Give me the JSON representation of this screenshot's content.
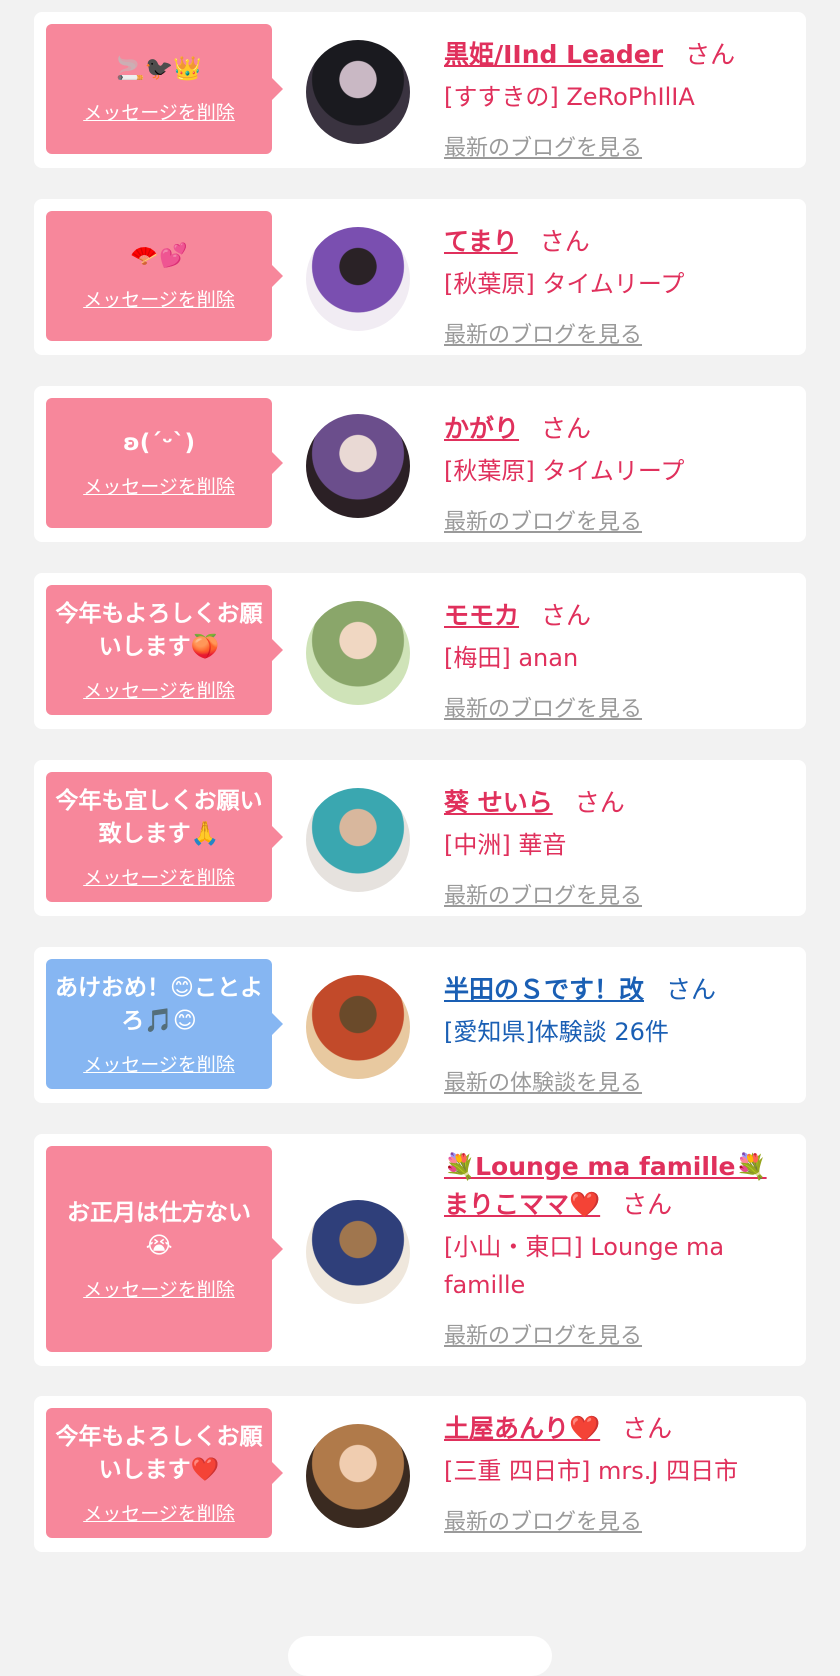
{
  "delete_label": "メッセージを削除",
  "san_label": "さん",
  "cards": [
    {
      "message": "🚬🐦‍⬛👑",
      "name": "黒姫/IInd Leader",
      "shop": "[すすきの] ZeRoPhIlIA",
      "latest": "最新のブログを見る",
      "theme": "pink",
      "avatar_colors": [
        "#3a3340",
        "#1a1a1f",
        "#c9b8c4"
      ]
    },
    {
      "message": "🪭💕",
      "name": "てまり",
      "shop": "[秋葉原] タイムリープ",
      "latest": "最新のブログを見る",
      "theme": "pink",
      "avatar_colors": [
        "#f1ecf3",
        "#7a4fb0",
        "#2a2226"
      ]
    },
    {
      "message": "ʚ(ˊᵕˋ)",
      "name": "かがり",
      "shop": "[秋葉原] タイムリープ",
      "latest": "最新のブログを見る",
      "theme": "pink",
      "avatar_colors": [
        "#2b2025",
        "#6b4e8c",
        "#e9d9d4"
      ]
    },
    {
      "message": "今年もよろしくお願いします🍑",
      "name": "モモカ",
      "shop": "[梅田] anan",
      "latest": "最新のブログを見る",
      "theme": "pink",
      "avatar_colors": [
        "#cfe3b8",
        "#8aa66a",
        "#f0d7c2"
      ]
    },
    {
      "message": "今年も宜しくお願い致します🙏",
      "name": "葵 せいら",
      "shop": "[中洲] 華音",
      "latest": "最新のブログを見る",
      "theme": "pink",
      "avatar_colors": [
        "#e6e2de",
        "#3aa7b0",
        "#d8b79d"
      ]
    },
    {
      "message": "あけおめ！😊ことよろ🎵😊",
      "name": "半田のＳです！改",
      "shop": "[愛知県]体験談 26件",
      "latest": "最新の体験談を見る",
      "theme": "blue",
      "avatar_colors": [
        "#e8c9a0",
        "#c24a2a",
        "#6a4a2a"
      ]
    },
    {
      "message": "お正月は仕方ない😭",
      "name": "💐Lounge ma famille💐まりこママ❤️",
      "shop": "[小山・東口] Lounge ma famille",
      "latest": "最新のブログを見る",
      "theme": "pink",
      "avatar_colors": [
        "#efe7dc",
        "#2f3f7a",
        "#a0764e"
      ]
    },
    {
      "message": "今年もよろしくお願いします❤️",
      "name": "土屋あんり❤️",
      "shop": "[三重 四日市] mrs.J 四日市",
      "latest": "最新のブログを見る",
      "theme": "pink",
      "avatar_colors": [
        "#3a2a20",
        "#b07a4a",
        "#f0cdb0"
      ]
    }
  ]
}
